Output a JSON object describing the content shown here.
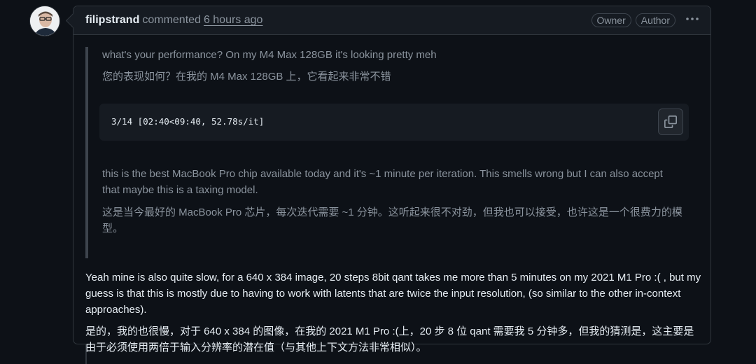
{
  "comment": {
    "author": "filipstrand",
    "action": "commented",
    "time": "6 hours ago",
    "badges": [
      "Owner",
      "Author"
    ],
    "menu_icon": "kebab-horizontal-icon",
    "avatar_icon": "user-avatar"
  },
  "quote": {
    "line1": "what's your performance? On my M4 Max 128GB it's looking pretty meh",
    "line1_translation": "您的表现如何？在我的 M4 Max 128GB 上，它看起来非常不错",
    "code": "3/14 [02:40<09:40, 52.78s/it]",
    "copy_icon": "copy-icon",
    "line2": "this is the best MacBook Pro chip available today and it's ~1 minute per iteration. This smells wrong but I can also accept that maybe this is a taxing model.",
    "line2_translation": "这是当今最好的 MacBook Pro 芯片，每次迭代需要 ~1 分钟。这听起来很不对劲，但我也可以接受，也许这是一个很费力的模型。"
  },
  "reply": {
    "text": "Yeah mine is also quite slow, for a 640 x 384 image, 20 steps 8bit qant takes me more than 5 minutes on my 2021 M1 Pro :( , but my guess is that this is mostly due to having to work with latents that are twice the input resolution, (so similar to the other in-context approaches).",
    "translation": "是的，我的也很慢，对于 640 x 384 的图像，在我的 2021 M1 Pro :(上，20 步 8 位 qant 需要我 5 分钟多，但我的猜测是，这主要是由于必须使用两倍于输入分辨率的潜在值（与其他上下文方法非常相似）。"
  },
  "colors": {
    "background": "#0d1117",
    "header": "#161b22",
    "border": "#30363d",
    "muted_text": "#8b949e",
    "text": "#e6edf3"
  }
}
